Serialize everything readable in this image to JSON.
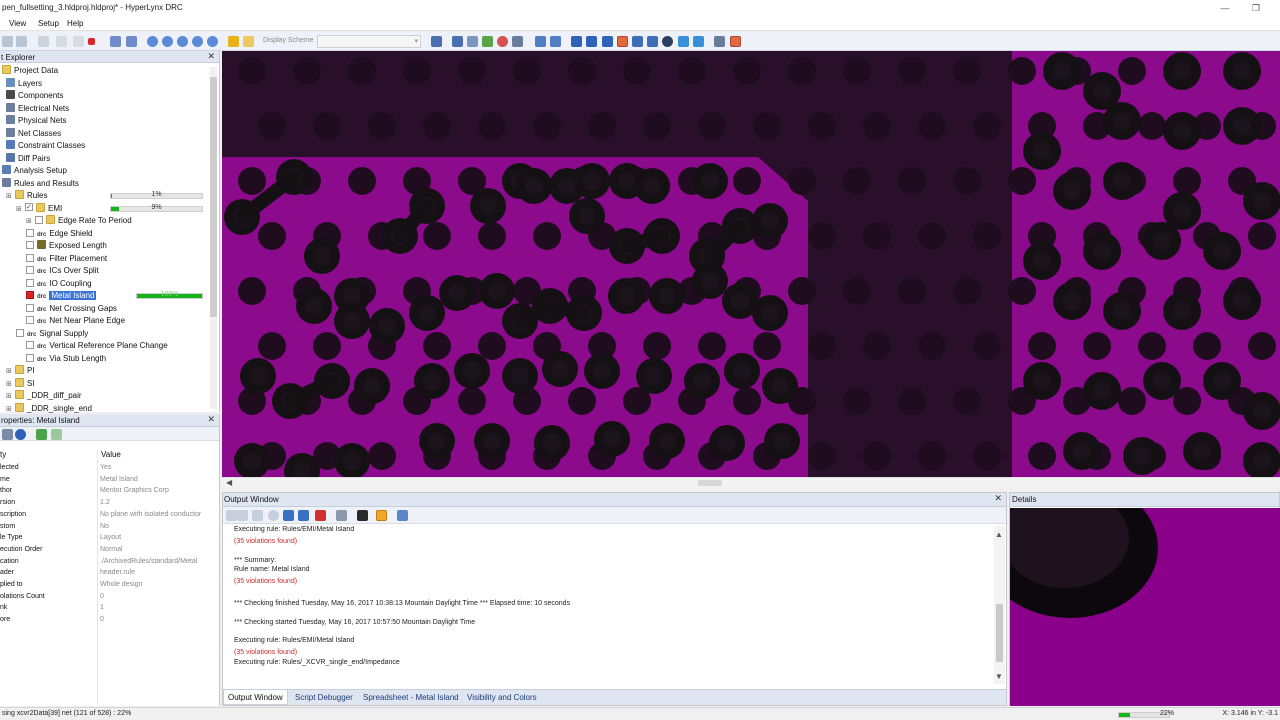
{
  "window": {
    "title": "pen_fullsetting_3.hldproj.hldproj* - HyperLynx DRC",
    "minimize_icon": "minimize-icon",
    "restore_icon": "restore-icon"
  },
  "menu": {
    "items": [
      "View",
      "Setup",
      "Help"
    ]
  },
  "toolbar": {
    "display_scheme_label": "Display Scheme",
    "display_scheme_value": ""
  },
  "explorer": {
    "title": "t Explorer",
    "close": "✕",
    "items": [
      {
        "label": "Project Data",
        "depth": 0,
        "icon": "folder"
      },
      {
        "label": "Layers",
        "depth": 1,
        "icon": "layers"
      },
      {
        "label": "Components",
        "depth": 1,
        "icon": "component"
      },
      {
        "label": "Electrical Nets",
        "depth": 1,
        "icon": "nets"
      },
      {
        "label": "Physical Nets",
        "depth": 1,
        "icon": "nets"
      },
      {
        "label": "Net Classes",
        "depth": 1,
        "icon": "nets"
      },
      {
        "label": "Constraint Classes",
        "depth": 1,
        "icon": "constraint"
      },
      {
        "label": "Diff Pairs",
        "depth": 1,
        "icon": "diffpair"
      },
      {
        "label": "Analysis Setup",
        "depth": 0,
        "icon": "setup"
      },
      {
        "label": "Rules and Results",
        "depth": 0,
        "icon": "rules"
      },
      {
        "label": "Rules",
        "depth": 1,
        "icon": "folder",
        "progress": 1,
        "progress_text": "1%"
      },
      {
        "label": "EMI",
        "depth": 2,
        "icon": "folder",
        "progress": 9,
        "progress_text": "9%"
      },
      {
        "label": "Edge Rate To Period",
        "depth": 3,
        "icon": "folder"
      },
      {
        "label": "Edge Shield",
        "depth": 3,
        "icon": "drc"
      },
      {
        "label": "Exposed Length",
        "depth": 3,
        "icon": "special"
      },
      {
        "label": "Filter Placement",
        "depth": 3,
        "icon": "drc"
      },
      {
        "label": "ICs Over Split",
        "depth": 3,
        "icon": "drc"
      },
      {
        "label": "IO Coupling",
        "depth": 3,
        "icon": "drc"
      },
      {
        "label": "Metal Island",
        "depth": 3,
        "icon": "drc",
        "selected": true,
        "progress": 100,
        "progress_text": "100%"
      },
      {
        "label": "Net Crossing Gaps",
        "depth": 3,
        "icon": "drc"
      },
      {
        "label": "Net Near Plane Edge",
        "depth": 3,
        "icon": "drc"
      },
      {
        "label": "Signal Supply",
        "depth": 2,
        "icon": "drc"
      },
      {
        "label": "Vertical Reference Plane Change",
        "depth": 3,
        "icon": "drc"
      },
      {
        "label": "Via Stub Length",
        "depth": 3,
        "icon": "drc"
      },
      {
        "label": "PI",
        "depth": 1,
        "icon": "folder"
      },
      {
        "label": "SI",
        "depth": 1,
        "icon": "folder"
      },
      {
        "label": "_DDR_diff_pair",
        "depth": 1,
        "icon": "folder"
      },
      {
        "label": "_DDR_single_end",
        "depth": 1,
        "icon": "folder"
      }
    ]
  },
  "properties": {
    "title": "roperties: Metal Island",
    "close": "✕",
    "header_key": "ty",
    "header_value": "Value",
    "rows": [
      {
        "k": "lected",
        "v": "Yes"
      },
      {
        "k": "me",
        "v": "Metal Island"
      },
      {
        "k": "thor",
        "v": "Mentor Graphics Corp"
      },
      {
        "k": "rsion",
        "v": "1.2"
      },
      {
        "k": "scription",
        "v": "No plane with isolated conductor"
      },
      {
        "k": "stom",
        "v": "No"
      },
      {
        "k": "le Type",
        "v": "Layout"
      },
      {
        "k": "ecution Order",
        "v": "Normal"
      },
      {
        "k": "cation",
        "v": "./ArchivedRules/standard/Metal"
      },
      {
        "k": "ader",
        "v": "header.rule"
      },
      {
        "k": "plied to",
        "v": "Whole design"
      },
      {
        "k": "olations Count",
        "v": "0"
      },
      {
        "k": "nk",
        "v": "1"
      },
      {
        "k": "ore",
        "v": "0"
      }
    ]
  },
  "output": {
    "title": "Output Window",
    "close": "✕",
    "lines": [
      {
        "t": "Executing rule: Rules/EMI/Metal Island",
        "red": false
      },
      {
        "t": "(35 violations found)",
        "red": true
      },
      {
        "t": "",
        "red": false
      },
      {
        "t": "*** Summary:",
        "red": false
      },
      {
        "t": "Rule name: Metal Island",
        "red": false
      },
      {
        "t": "(35 violations found)",
        "red": true
      },
      {
        "t": "",
        "red": false
      },
      {
        "t": "*** Checking finished Tuesday, May 16, 2017 10:38:13 Mountain Daylight Time *** Elapsed time: 10 seconds",
        "red": false
      },
      {
        "t": "",
        "red": false
      },
      {
        "t": "*** Checking started Tuesday, May 16, 2017 10:57:50 Mountain Daylight Time",
        "red": false
      },
      {
        "t": "",
        "red": false
      },
      {
        "t": "Executing rule: Rules/EMI/Metal Island",
        "red": false
      },
      {
        "t": "(35 violations found)",
        "red": true
      },
      {
        "t": "Executing rule: Rules/_XCVR_single_end/Impedance",
        "red": false
      }
    ],
    "tabs": [
      "Output Window",
      "Script Debugger",
      "Spreadsheet - Metal Island",
      "Visibility and Colors"
    ]
  },
  "details": {
    "title": "Details"
  },
  "status": {
    "text": "sing xcvr2Data[39] net (121 of 528) : 22%",
    "progress": 22,
    "progress_text": "22%",
    "coords": "X: 3.146 in  Y: -3.1"
  },
  "colors": {
    "plane": "#8c0a8c",
    "plane_dark": "#2a0f2a",
    "via": "#141014",
    "accent": "#17b31c",
    "selection": "#3874d8"
  }
}
